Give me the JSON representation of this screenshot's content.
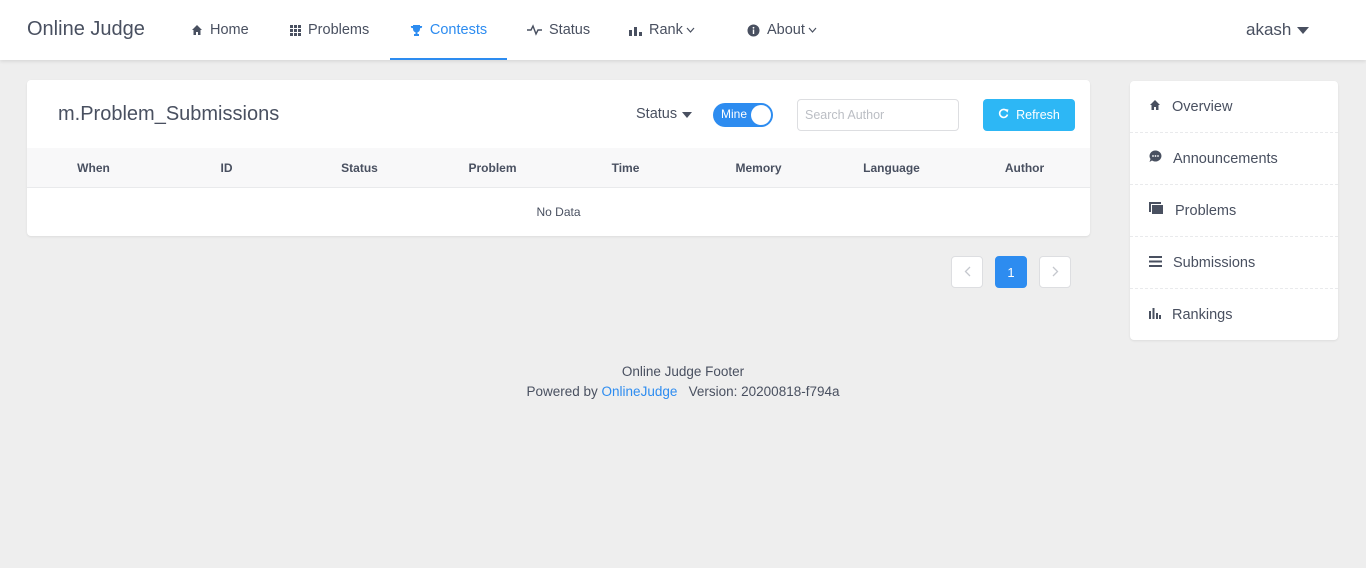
{
  "header": {
    "brand": "Online Judge",
    "nav": [
      {
        "label": "Home",
        "icon": "home-icon"
      },
      {
        "label": "Problems",
        "icon": "grid-icon"
      },
      {
        "label": "Contests",
        "icon": "trophy-icon",
        "active": true
      },
      {
        "label": "Status",
        "icon": "pulse-icon"
      },
      {
        "label": "Rank",
        "icon": "bar-chart-icon",
        "dropdown": true
      },
      {
        "label": "About",
        "icon": "info-icon",
        "dropdown": true
      }
    ],
    "user": "akash"
  },
  "main": {
    "title": "m.Problem_Submissions",
    "status_filter": "Status",
    "toggle_label": "Mine",
    "toggle_on": true,
    "search_placeholder": "Search Author",
    "refresh_label": "Refresh",
    "columns": [
      "When",
      "ID",
      "Status",
      "Problem",
      "Time",
      "Memory",
      "Language",
      "Author"
    ],
    "no_data": "No Data"
  },
  "pagination": {
    "current": "1"
  },
  "sidebar": {
    "items": [
      {
        "label": "Overview",
        "icon": "home-icon"
      },
      {
        "label": "Announcements",
        "icon": "chat-bubble-icon"
      },
      {
        "label": "Problems",
        "icon": "book-icon"
      },
      {
        "label": "Submissions",
        "icon": "list-icon"
      },
      {
        "label": "Rankings",
        "icon": "bar-chart-icon"
      }
    ]
  },
  "footer": {
    "line1": "Online Judge Footer",
    "powered_prefix": "Powered by",
    "powered_link": "OnlineJudge",
    "version": "Version: 20200818-f794a"
  },
  "colors": {
    "primary": "#2d8cf0",
    "refresh": "#2db7f5",
    "background": "#eeeeee",
    "text": "#495060"
  }
}
